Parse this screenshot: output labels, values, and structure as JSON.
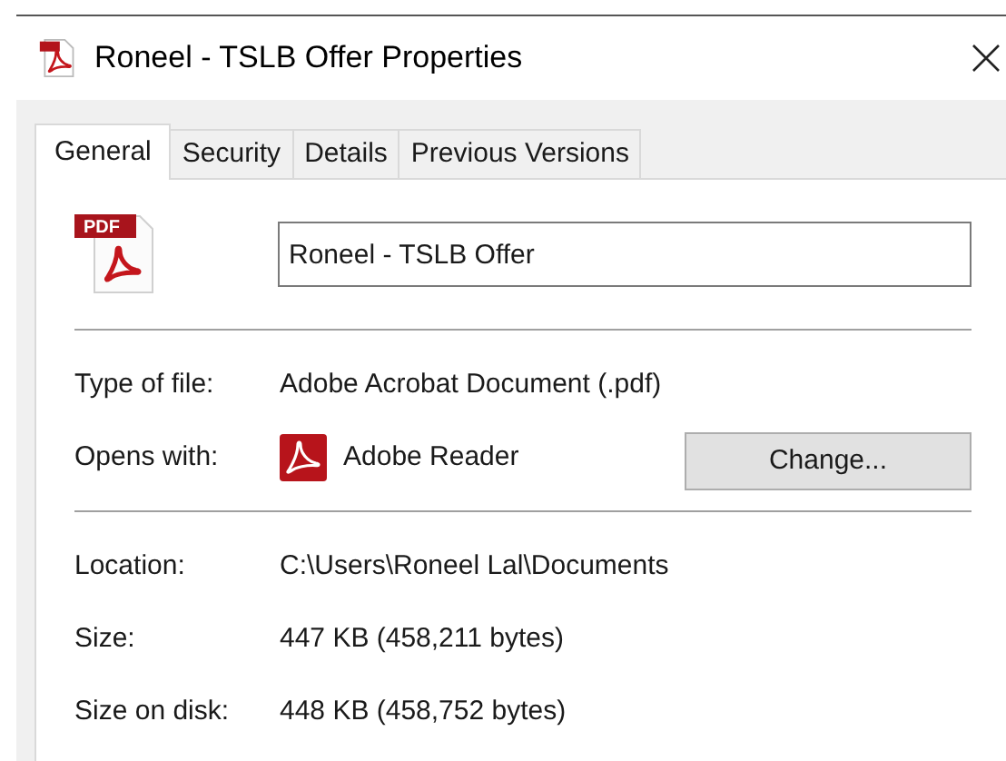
{
  "window": {
    "title": "Roneel - TSLB Offer Properties"
  },
  "tabs": [
    {
      "label": "General",
      "selected": true
    },
    {
      "label": "Security",
      "selected": false
    },
    {
      "label": "Details",
      "selected": false
    },
    {
      "label": "Previous Versions",
      "selected": false
    }
  ],
  "file_icon_label": "PDF",
  "name_field": {
    "value": "Roneel - TSLB Offer"
  },
  "type_of_file": {
    "label": "Type of file:",
    "value": "Adobe Acrobat Document (.pdf)"
  },
  "opens_with": {
    "label": "Opens with:",
    "value": "Adobe Reader",
    "button": "Change..."
  },
  "details": [
    {
      "label": "Location:",
      "value": "C:\\Users\\Roneel Lal\\Documents"
    },
    {
      "label": "Size:",
      "value": "447 KB (458,211 bytes)"
    },
    {
      "label": "Size on disk:",
      "value": "448 KB (458,752 bytes)"
    }
  ]
}
